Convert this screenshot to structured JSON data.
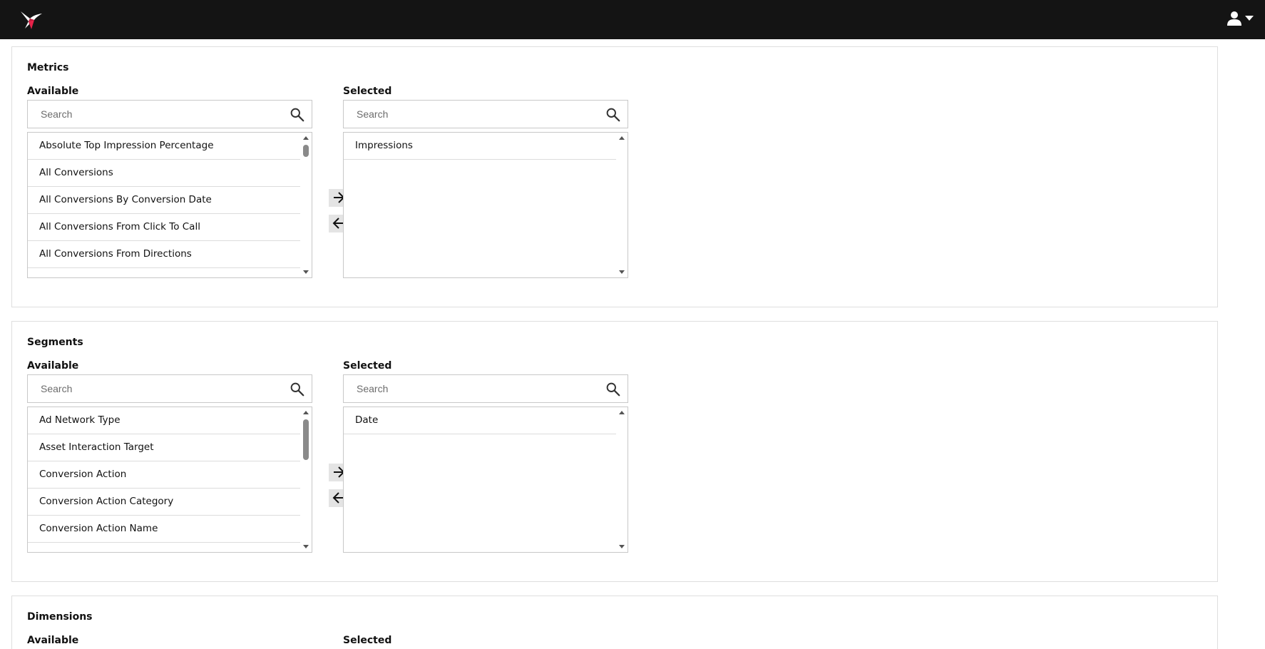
{
  "header": {
    "logo_icon": "hummingbird-logo-icon",
    "user_icon": "user-icon",
    "dropdown_icon": "caret-down-icon",
    "background": "#141414",
    "logo_accent": "#e8234a"
  },
  "metrics": {
    "title": "Metrics",
    "available": {
      "label": "Available",
      "search_placeholder": "Search",
      "items": [
        "Absolute Top Impression Percentage",
        "All Conversions",
        "All Conversions By Conversion Date",
        "All Conversions From Click To Call",
        "All Conversions From Directions"
      ]
    },
    "selected": {
      "label": "Selected",
      "search_placeholder": "Search",
      "items": [
        "Impressions"
      ]
    },
    "move_right_icon": "arrow-right-icon",
    "move_left_icon": "arrow-left-icon"
  },
  "segments": {
    "title": "Segments",
    "available": {
      "label": "Available",
      "search_placeholder": "Search",
      "items": [
        "Ad Network Type",
        "Asset Interaction Target",
        "Conversion Action",
        "Conversion Action Category",
        "Conversion Action Name"
      ]
    },
    "selected": {
      "label": "Selected",
      "search_placeholder": "Search",
      "items": [
        "Date"
      ]
    },
    "move_right_icon": "arrow-right-icon",
    "move_left_icon": "arrow-left-icon"
  },
  "dimensions": {
    "title": "Dimensions",
    "available": {
      "label": "Available"
    },
    "selected": {
      "label": "Selected"
    }
  }
}
